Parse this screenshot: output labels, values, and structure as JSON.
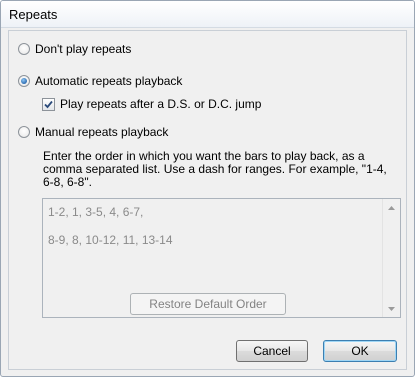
{
  "window": {
    "title": "Repeats"
  },
  "options": {
    "dont_play": {
      "label": "Don't play repeats",
      "selected": false
    },
    "automatic": {
      "label": "Automatic repeats playback",
      "selected": true
    },
    "play_after_jump": {
      "label": "Play repeats after a D.S. or D.C. jump",
      "checked": true
    },
    "manual": {
      "label": "Manual repeats playback",
      "selected": false
    }
  },
  "manual_section": {
    "description": "Enter the order in which you want the bars to play back, as a comma separated list. Use a dash for ranges. For example, \"1-4, 6-8, 6-8\".",
    "order_lines": [
      "1-2, 1, 3-5, 4, 6-7,",
      "",
      "8-9, 8, 10-12, 11, 13-14"
    ],
    "restore_label": "Restore Default Order"
  },
  "buttons": {
    "cancel": "Cancel",
    "ok": "OK"
  }
}
